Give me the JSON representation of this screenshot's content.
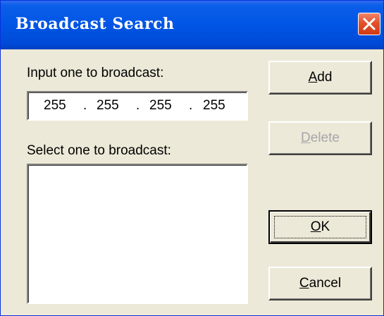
{
  "window": {
    "title": "Broadcast Search"
  },
  "labels": {
    "input": "Input one to broadcast:",
    "select": "Select one to broadcast:"
  },
  "ip_address": {
    "octets": [
      "255",
      "255",
      "255",
      "255"
    ],
    "separator": "."
  },
  "buttons": {
    "add": {
      "accel": "A",
      "rest": "dd",
      "enabled": true,
      "default": false
    },
    "delete": {
      "accel": "D",
      "rest": "elete",
      "enabled": false,
      "default": false
    },
    "ok": {
      "accel": "O",
      "rest": "K",
      "enabled": true,
      "default": true
    },
    "cancel": {
      "accel": "C",
      "rest": "ancel",
      "enabled": true,
      "default": false
    }
  },
  "broadcast_list": {
    "items": []
  },
  "icons": {
    "close": "close-icon"
  },
  "colors": {
    "titlebar": "#0055e5",
    "face": "#ece9d8",
    "close": "#e2512b",
    "disabled_text": "#a7a6aa"
  }
}
